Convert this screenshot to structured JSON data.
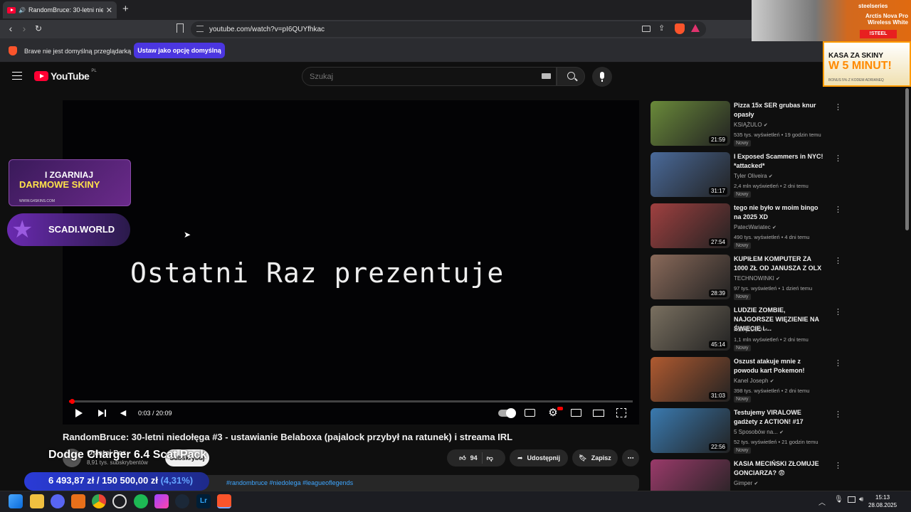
{
  "browser": {
    "tab_title": "RandomBruce: 30-letni niedo",
    "url": "youtube.com/watch?v=pI6QUYfhkac",
    "infobar_text": "Brave nie jest domyślną przeglądarką",
    "infobar_button": "Ustaw jako opcję domyślną"
  },
  "youtube": {
    "logo": "YouTube",
    "country": "PL",
    "search_placeholder": "Szukaj"
  },
  "player": {
    "overlay_text": "Ostatni Raz prezentuje",
    "time": "0:03 / 20:09",
    "progress_fraction": 0.0025
  },
  "video": {
    "title": "RandomBruce: 30-letni niedołęga #3 - ustawianie Belaboxa (pajalock przybył na ratunek) i streama IRL",
    "channel": "Ostatni Raz",
    "subscribers": "8,91 tys. subskrybentów",
    "subscribe": "Subskrybuj",
    "likes": "94",
    "share": "Udostępnij",
    "save": "Zapisz",
    "description_tags": "#randombruce #niedolega #leagueoflegends"
  },
  "overlays": {
    "donation_title": "Dodge Charger 6.4 Scat Pack",
    "donation_current": "6 493,87 zł",
    "donation_goal": "150 500,00 zł",
    "donation_pct": "(4,31%)",
    "ad1_line1": "I ZGARNIAJ",
    "ad1_line2": "DARMOWE SKINY",
    "ad1_url": "WWW.G4SKINS.COM",
    "ad2_text": "SCADI.WORLD",
    "ad3_brand": "steelseries",
    "ad3_product": "Arctis Nova Pro Wireless White",
    "ad3_button": "!STEEL",
    "ad4_line1": "KASA ZA SKINY",
    "ad4_line2": "W 5 MINUT!",
    "ad4_line3": "BONUS 5% Z KODEM ADRIANEQ"
  },
  "related": [
    {
      "title": "Pizza 15x SER grubas knur opasły",
      "channel": "KSIĄŻULO",
      "meta": "535 tys. wyświetleń • 19 godzin temu",
      "badge": "Nowy",
      "duration": "21:59",
      "color": "#6a8a3a"
    },
    {
      "title": "I Exposed Scammers in NYC! *attacked*",
      "channel": "Tyler Oliveira",
      "meta": "2,4 mln wyświetleń • 2 dni temu",
      "badge": "Nowy",
      "duration": "31:17",
      "color": "#4a6a9a"
    },
    {
      "title": "tego nie było w moim bingo na 2025 XD",
      "channel": "PatecWariatec",
      "meta": "490 tys. wyświetleń • 4 dni temu",
      "badge": "Nowy",
      "duration": "27:54",
      "color": "#a04040"
    },
    {
      "title": "KUPIŁEM KOMPUTER ZA 1000 ZŁ OD JANUSZA Z OLX",
      "channel": "TECHNOWINKI",
      "meta": "97 tys. wyświetleń • 1 dzień temu",
      "badge": "Nowy",
      "duration": "28:39",
      "color": "#8a6a5a"
    },
    {
      "title": "LUDZIE ZOMBIE, NAJGORSZE WIĘZIENIE NA ŚWIECIE i ...",
      "channel": "KSIĄŻULO",
      "meta": "1,1 mln wyświetleń • 2 dni temu",
      "badge": "Nowy",
      "duration": "45:14",
      "color": "#7a7060"
    },
    {
      "title": "Oszust atakuje mnie z powodu kart Pokemon!",
      "channel": "Kanel Joseph",
      "meta": "398 tys. wyświetleń • 2 dni temu",
      "badge": "Nowy",
      "duration": "31:03",
      "color": "#b05a30"
    },
    {
      "title": "Testujemy VIRALOWE gadżety z ACTION! #17",
      "channel": "5 Sposobów na...",
      "meta": "52 tys. wyświetleń • 21 godzin temu",
      "badge": "Nowy",
      "duration": "22:56",
      "color": "#3a7ab0"
    },
    {
      "title": "KASIA MECIŃSKI ZŁOMUJE GONCIARZA? 😨",
      "channel": "Gimper",
      "meta": "",
      "badge": "",
      "duration": "",
      "color": "#9a3a6a"
    }
  ],
  "taskbar": {
    "time": "15:13",
    "date": "28.08.2025",
    "lr_label": "Lr"
  }
}
